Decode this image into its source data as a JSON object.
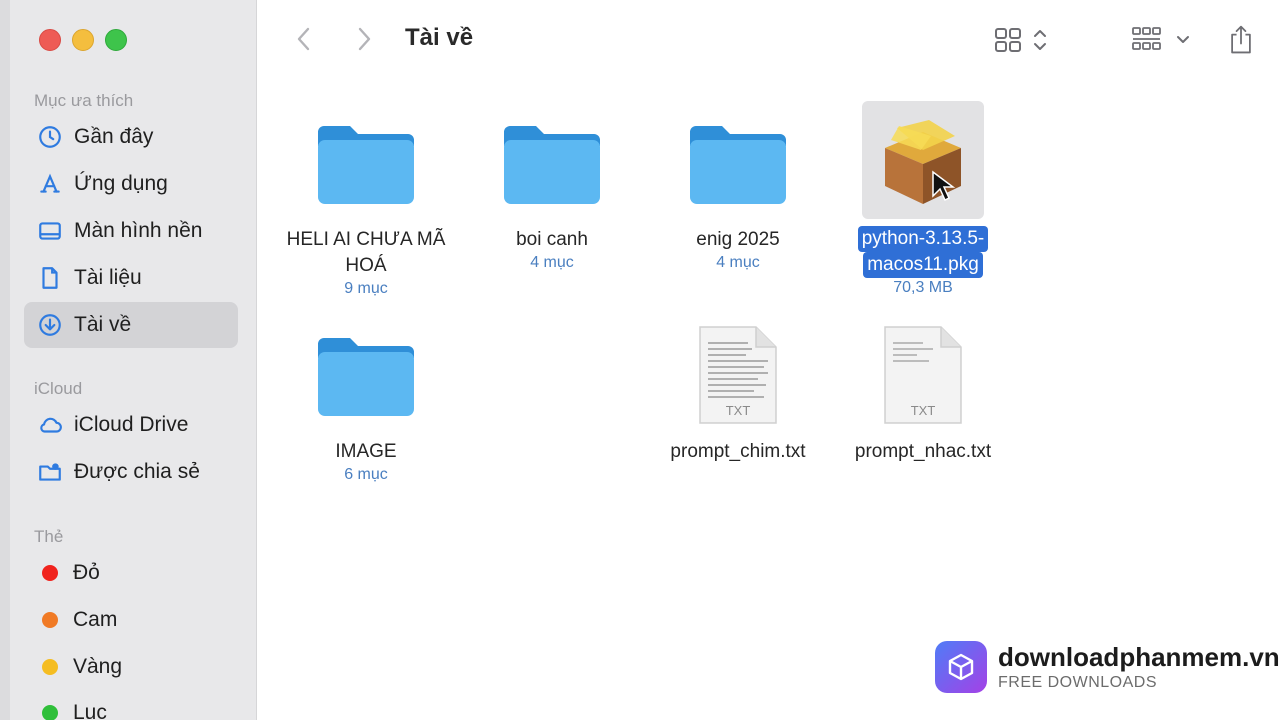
{
  "window": {
    "title": "Tài về"
  },
  "sidebar": {
    "favorites_header": "Mục ưa thích",
    "favorites": [
      {
        "label": "Gần đây",
        "icon": "clock-icon"
      },
      {
        "label": "Ứng dụng",
        "icon": "apps-icon"
      },
      {
        "label": "Màn hình nền",
        "icon": "desktop-icon"
      },
      {
        "label": "Tài liệu",
        "icon": "document-icon"
      },
      {
        "label": "Tài về",
        "icon": "download-icon",
        "active": true
      }
    ],
    "icloud_header": "iCloud",
    "icloud": [
      {
        "label": "iCloud Drive",
        "icon": "cloud-icon"
      },
      {
        "label": "Được chia sẻ",
        "icon": "shared-folder-icon"
      }
    ],
    "tags_header": "Thẻ",
    "tags": [
      {
        "label": "Đỏ",
        "color": "#f0231d"
      },
      {
        "label": "Cam",
        "color": "#f07a25"
      },
      {
        "label": "Vàng",
        "color": "#f5bd22"
      },
      {
        "label": "Lục",
        "color": "#2fbf3a"
      }
    ]
  },
  "files": [
    {
      "name_line1": "HELI AI CHƯA MÃ",
      "name_line2": "HOÁ",
      "meta": "9 mục",
      "kind": "folder"
    },
    {
      "name_line1": "boi canh",
      "name_line2": "",
      "meta": "4 mục",
      "kind": "folder"
    },
    {
      "name_line1": "enig 2025",
      "name_line2": "",
      "meta": "4 mục",
      "kind": "folder"
    },
    {
      "name_line1": "python-3.13.5-",
      "name_line2": "macos11.pkg",
      "meta": "70,3 MB",
      "kind": "package",
      "selected": true
    },
    {
      "name_line1": "IMAGE",
      "name_line2": "",
      "meta": "6 mục",
      "kind": "folder"
    },
    {
      "name_line1": "prompt_chim.txt",
      "name_line2": "",
      "meta": "",
      "kind": "txt",
      "badge": "TXT"
    },
    {
      "name_line1": "prompt_nhac.txt",
      "name_line2": "",
      "meta": "",
      "kind": "txt",
      "badge": "TXT"
    }
  ],
  "watermark": {
    "title": "downloadphanmem.vn",
    "subtitle": "FREE DOWNLOADS"
  },
  "colors": {
    "accent": "#2f6fd6",
    "folder": "#5cb8f2",
    "sidebar_bg": "#e8e8ea"
  }
}
